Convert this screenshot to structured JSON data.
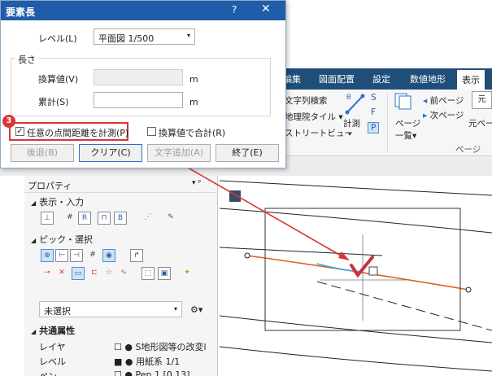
{
  "ribbon": {
    "tabs": [
      "編集",
      "図面配置",
      "設定",
      "数値地形",
      "表示"
    ],
    "active_tab_index": 4,
    "items": {
      "text_search": "文字列検索",
      "map_tile": "地理院タイル",
      "street_view": "ストリートビュー",
      "measure": "計測",
      "prev_page": "前ページ",
      "next_page": "次ページ",
      "page_list": "ページ一覧",
      "original_page": "元ペー",
      "page_group": "ページ",
      "s_label": "S",
      "f_label": "F",
      "p_label": "P"
    }
  },
  "dialog": {
    "title": "要素長",
    "help_glyph": "?",
    "close_glyph": "✕",
    "level_label": "レベル(L)",
    "level_value": "平面図 1/500",
    "length_group": "長さ",
    "converted_label": "換算値(V)",
    "converted_value": "",
    "converted_unit": "m",
    "cumulative_label": "累計(S)",
    "cumulative_value": "",
    "cumulative_unit": "m",
    "arbitrary_check_label": "任意の点間距離を計測(P)",
    "arbitrary_checked": true,
    "sum_converted_label": "換算値で合計(R)",
    "sum_converted_checked": false,
    "buttons": {
      "back": "後退(B)",
      "clear": "クリア(C)",
      "add_text": "文字追加(A)",
      "finish": "終了(E)"
    },
    "step_badge": "3"
  },
  "property_panel": {
    "title": "プロパティ",
    "pin_glyph": "▾ ᵖ",
    "section_display": "表示・入力",
    "section_pick": "ピック・選択",
    "selection_value": "未選択",
    "section_common": "共通属性",
    "rows": [
      {
        "label": "レイヤ",
        "value": "S地形図等の改変l"
      },
      {
        "label": "レベル",
        "value": "用紙系 1/1"
      },
      {
        "label": "ペン",
        "value": "Pen 1 [0.13]"
      }
    ]
  }
}
